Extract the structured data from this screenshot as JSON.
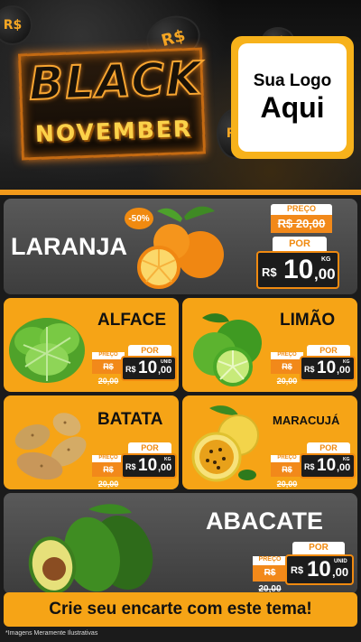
{
  "header": {
    "coin_symbol": "R$",
    "title_line1": "BLACK",
    "title_line2": "NOVEMBER",
    "logo_line1": "Sua Logo",
    "logo_line2": "Aqui"
  },
  "colors": {
    "accent": "#f6a416",
    "accent_dark": "#f08a10",
    "card_gray": "#4a4a4a",
    "price_bg": "#1c1c1c"
  },
  "products": {
    "laranja": {
      "name": "LARANJA",
      "badge": "-50%",
      "preco_label": "PREÇO",
      "old_price": "R$ 20,00",
      "por_label": "POR",
      "currency": "R$",
      "price_int": "10",
      "price_dec": ",00",
      "unit": "KG"
    },
    "alface": {
      "name": "ALFACE",
      "preco_label": "PREÇO",
      "old_price": "R$ 20,00",
      "por_label": "POR",
      "currency": "R$",
      "price_int": "10",
      "price_dec": ",00",
      "unit": "UNID"
    },
    "limao": {
      "name": "LIMÃO",
      "preco_label": "PREÇO",
      "old_price": "R$ 20,00",
      "por_label": "POR",
      "currency": "R$",
      "price_int": "10",
      "price_dec": ",00",
      "unit": "KG"
    },
    "batata": {
      "name": "BATATA",
      "preco_label": "PREÇO",
      "old_price": "R$ 20,00",
      "por_label": "POR",
      "currency": "R$",
      "price_int": "10",
      "price_dec": ",00",
      "unit": "KG"
    },
    "maracuja": {
      "name": "MARACUJÁ",
      "preco_label": "PREÇO",
      "old_price": "R$ 20,00",
      "por_label": "POR",
      "currency": "R$",
      "price_int": "10",
      "price_dec": ",00",
      "unit": "KG"
    },
    "abacate": {
      "name": "ABACATE",
      "preco_label": "PREÇO",
      "old_price": "R$ 20,00",
      "por_label": "POR",
      "currency": "R$",
      "price_int": "10",
      "price_dec": ",00",
      "unit": "UNID"
    }
  },
  "footer": {
    "cta": "Crie seu encarte com este tema!",
    "disclaimer": "*Imagens Meramente Ilustrativas"
  }
}
